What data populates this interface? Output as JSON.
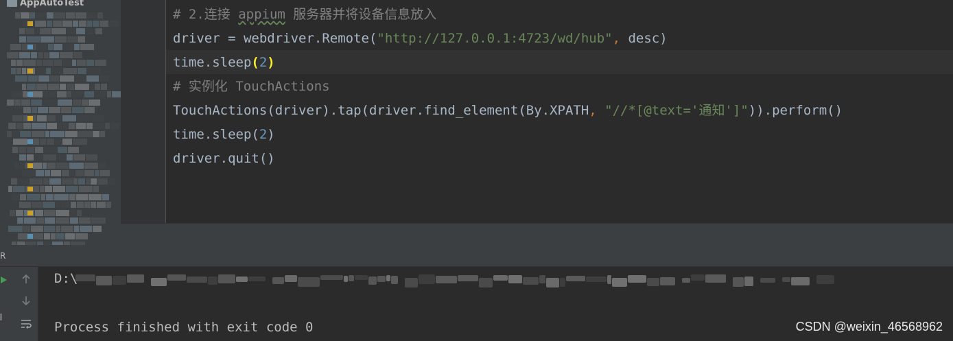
{
  "sidebar": {
    "project_name": "AppAutoTest"
  },
  "editor": {
    "lines": [
      {
        "parts": [
          {
            "t": "# 2.连接 ",
            "c": "cmt"
          },
          {
            "t": "appium",
            "c": "cmt spell"
          },
          {
            "t": " 服务器并将设备信息放入",
            "c": "cmt"
          }
        ]
      },
      {
        "parts": [
          {
            "t": "driver = webdriver.Remote(",
            "c": ""
          },
          {
            "t": "\"http://127.0.0.1:4723/wd/hub\"",
            "c": "str"
          },
          {
            "t": ",",
            "c": "kw"
          },
          {
            "t": " desc)",
            "c": ""
          }
        ]
      },
      {
        "parts": [
          {
            "t": "time.sleep",
            "c": ""
          },
          {
            "t": "(",
            "c": "paren-match"
          },
          {
            "t": "2",
            "c": "num"
          },
          {
            "t": ")",
            "c": "paren-match"
          }
        ]
      },
      {
        "parts": [
          {
            "t": "# 实例化 TouchActions",
            "c": "cmt"
          }
        ]
      },
      {
        "parts": [
          {
            "t": "TouchActions(driver).tap(driver.find_element(By.XPATH",
            "c": ""
          },
          {
            "t": ",",
            "c": "kw"
          },
          {
            "t": " ",
            "c": ""
          },
          {
            "t": "\"//*[@text='通知']\"",
            "c": "str"
          },
          {
            "t": ")).perform()",
            "c": ""
          }
        ]
      },
      {
        "parts": [
          {
            "t": "time.sleep(",
            "c": ""
          },
          {
            "t": "2",
            "c": "num"
          },
          {
            "t": ")",
            "c": ""
          }
        ]
      },
      {
        "parts": [
          {
            "t": "driver.quit()",
            "c": ""
          }
        ]
      }
    ]
  },
  "run_panel": {
    "tab_label": "R",
    "console_lines": [
      "D:\\",
      "",
      "Process finished with exit code 0"
    ],
    "icons": [
      "run-icon",
      "up-arrow-icon",
      "down-arrow-icon",
      "soft-wrap-icon"
    ]
  },
  "watermark": "CSDN @weixin_46568962",
  "colors": {
    "background": "#2b2b2b",
    "panel": "#3c3f41",
    "text": "#a9b7c6",
    "comment": "#808080",
    "string": "#6a8759",
    "number": "#6897bb",
    "keyword": "#cc7832",
    "run_green": "#499c54"
  }
}
